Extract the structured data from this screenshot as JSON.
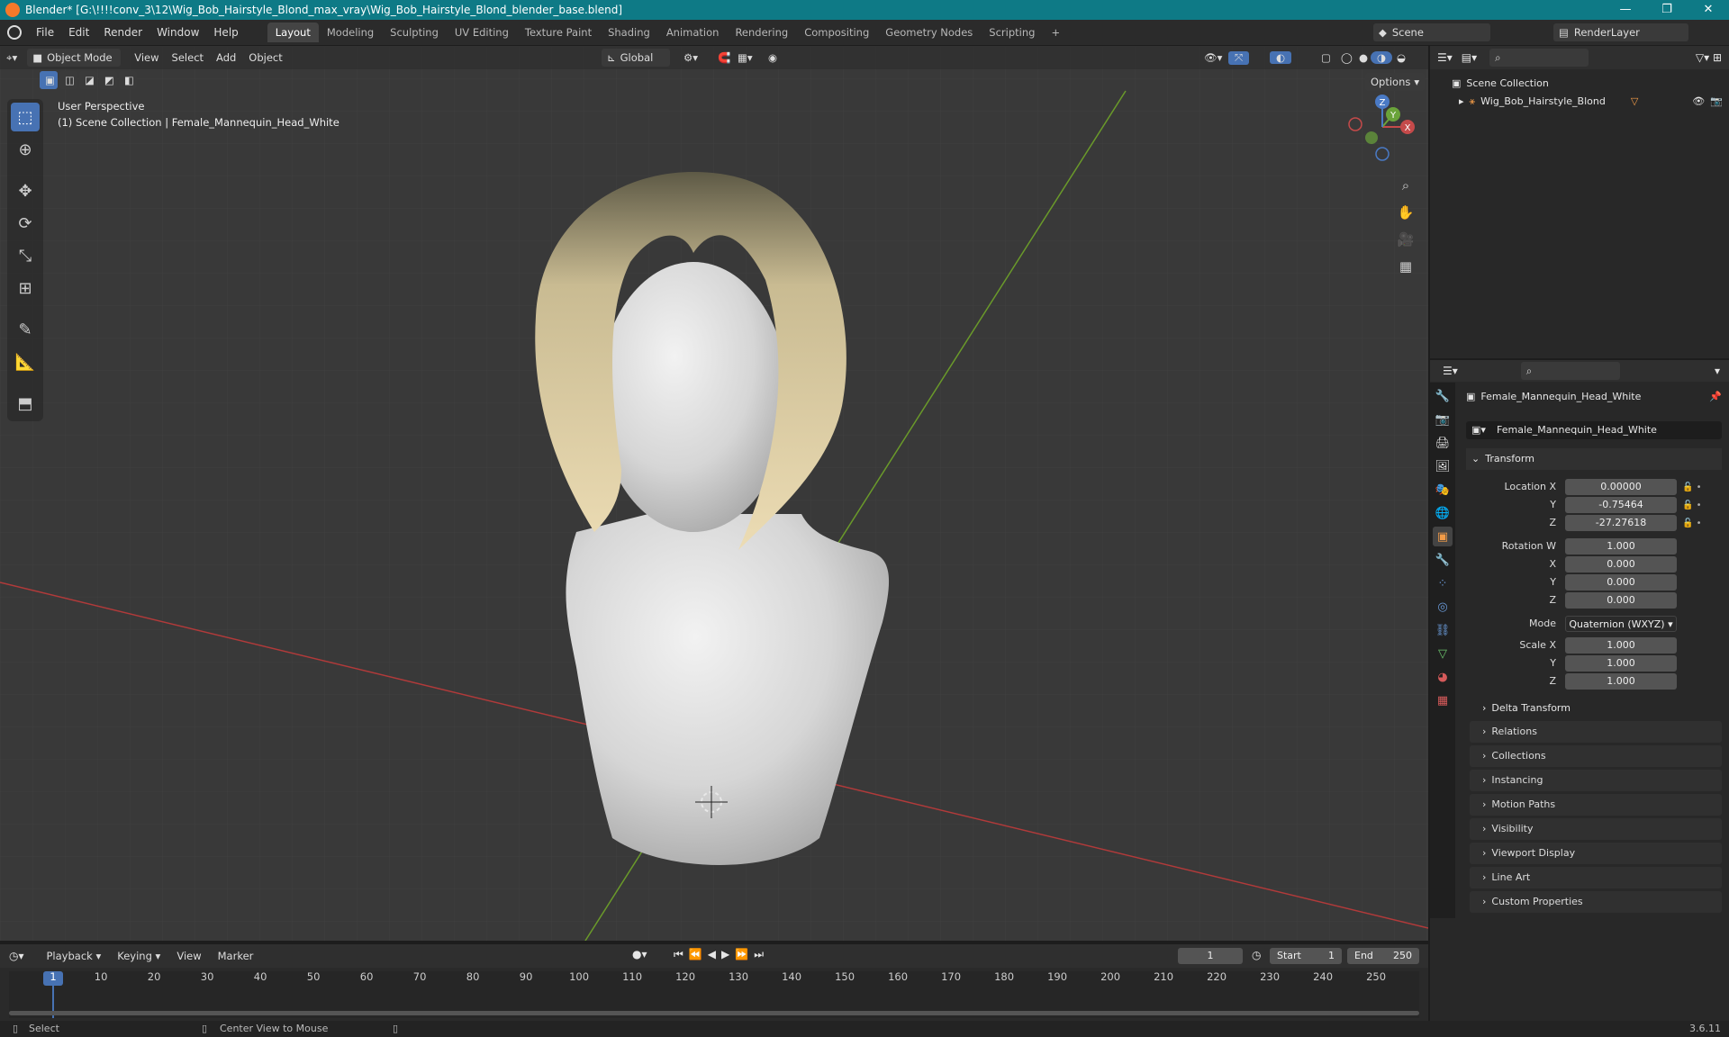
{
  "window": {
    "title": "Blender* [G:\\!!!!conv_3\\12\\Wig_Bob_Hairstyle_Blond_max_vray\\Wig_Bob_Hairstyle_Blond_blender_base.blend]",
    "minimize": "—",
    "maximize": "❐",
    "close": "✕"
  },
  "menus": [
    "File",
    "Edit",
    "Render",
    "Window",
    "Help"
  ],
  "workspaces": [
    "Layout",
    "Modeling",
    "Sculpting",
    "UV Editing",
    "Texture Paint",
    "Shading",
    "Animation",
    "Rendering",
    "Compositing",
    "Geometry Nodes",
    "Scripting",
    "+"
  ],
  "scene": {
    "name": "Scene",
    "render_layer": "RenderLayer"
  },
  "viewport_header": {
    "mode": "Object Mode",
    "menus": [
      "View",
      "Select",
      "Add",
      "Object"
    ],
    "orientation": "Global",
    "options": "Options"
  },
  "viewport": {
    "overlay_title": "User Perspective",
    "overlay_subtitle": "(1) Scene Collection | Female_Mannequin_Head_White",
    "gizmo": {
      "z": "Z",
      "y": "Y",
      "x": "X"
    }
  },
  "outliner": {
    "root": "Scene Collection",
    "item": "Wig_Bob_Hairstyle_Blond"
  },
  "properties": {
    "object_name": "Female_Mannequin_Head_White",
    "object_field": "Female_Mannequin_Head_White",
    "transform_label": "Transform",
    "location": {
      "label": "Location X",
      "x": "0.00000",
      "y_label": "Y",
      "y": "-0.75464",
      "z_label": "Z",
      "z": "-27.27618"
    },
    "rotation": {
      "label": "Rotation W",
      "w": "1.000",
      "x_label": "X",
      "x": "0.000",
      "y_label": "Y",
      "y": "0.000",
      "z_label": "Z",
      "z": "0.000"
    },
    "mode": {
      "label": "Mode",
      "value": "Quaternion (WXYZ)"
    },
    "scale": {
      "label": "Scale X",
      "x": "1.000",
      "y_label": "Y",
      "y": "1.000",
      "z_label": "Z",
      "z": "1.000"
    },
    "delta": "Delta Transform",
    "panels": [
      "Relations",
      "Collections",
      "Instancing",
      "Motion Paths",
      "Visibility",
      "Viewport Display",
      "Line Art",
      "Custom Properties"
    ]
  },
  "timeline": {
    "menus": [
      "Playback",
      "Keying",
      "View",
      "Marker"
    ],
    "current_frame": "1",
    "start_label": "Start",
    "start": "1",
    "end_label": "End",
    "end": "250",
    "ticks": [
      "1",
      "10",
      "20",
      "30",
      "40",
      "50",
      "60",
      "70",
      "80",
      "90",
      "100",
      "110",
      "120",
      "130",
      "140",
      "150",
      "160",
      "170",
      "180",
      "190",
      "200",
      "210",
      "220",
      "230",
      "240",
      "250"
    ]
  },
  "status": {
    "select": "Select",
    "center": "Center View to Mouse",
    "version": "3.6.11"
  },
  "colors": {
    "accent": "#4772b3",
    "titlebar": "#0e7a86",
    "x_axis": "#b13a3a",
    "y_axis": "#6a9a2a"
  }
}
